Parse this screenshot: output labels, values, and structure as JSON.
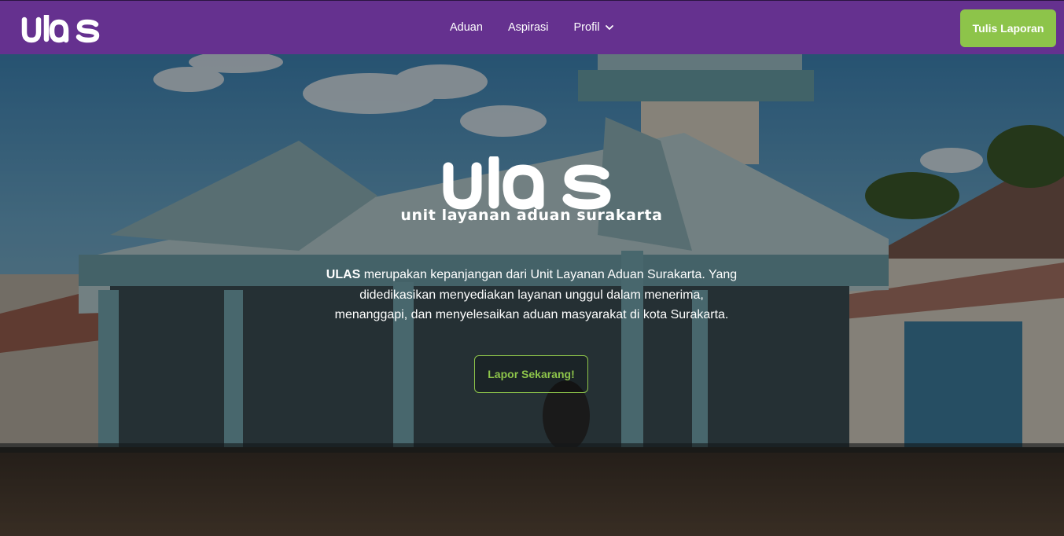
{
  "navbar": {
    "logo_text": "ulas",
    "links": {
      "aduan": "Aduan",
      "aspirasi": "Aspirasi",
      "profil": "Profil"
    },
    "cta_label": "Tulis Laporan"
  },
  "hero": {
    "logo_text": "ulas",
    "tagline": "unit layanan aduan surakarta",
    "description_bold": "ULAS",
    "description_rest": " merupakan kepanjangan dari Unit Layanan Aduan Surakarta. Yang didedikasikan menyediakan layanan unggul dalam menerima, menanggapi, dan menyelesaikan aduan masyarakat di kota Surakarta.",
    "cta_label": "Lapor Sekarang!"
  },
  "colors": {
    "navbar_bg": "#65318f",
    "accent_green": "#8dc44a",
    "text_white": "#ffffff"
  },
  "icons": {
    "profil_dropdown": "chevron-down-icon"
  }
}
